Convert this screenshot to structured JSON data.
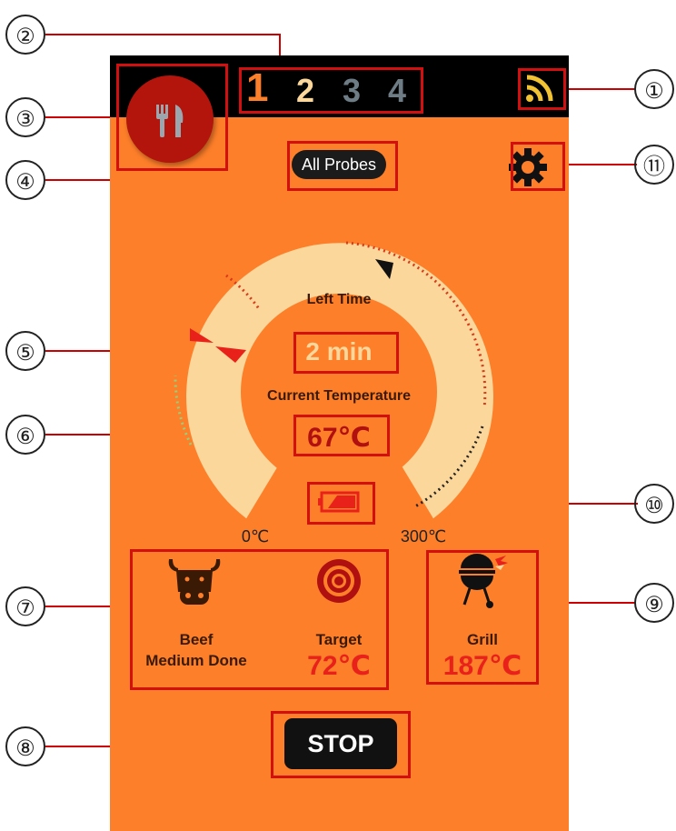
{
  "annotations": {
    "n1": "①",
    "n2": "②",
    "n3": "③",
    "n4": "④",
    "n5": "⑤",
    "n6": "⑥",
    "n7": "⑦",
    "n8": "⑧",
    "n9": "⑨",
    "n10": "⑩",
    "n11": "⑪"
  },
  "topbar": {
    "probes": [
      "1",
      "2",
      "3",
      "4"
    ],
    "selected_probe": "1",
    "wifi_icon": "wifi-signal-icon"
  },
  "header": {
    "menu_icon": "fork-knife-icon",
    "all_probes_label": "All Probes",
    "settings_icon": "gear-icon"
  },
  "gauge": {
    "left_time_label": "Left Time",
    "left_time_value": "2 min",
    "current_temp_label": "Current Temperature",
    "current_temp_value": "67℃",
    "min_label": "0℃",
    "max_label": "300℃",
    "battery_icon": "battery-low-icon"
  },
  "meat": {
    "icon": "cow-icon",
    "name": "Beef",
    "doneness": "Medium Done",
    "target_icon": "target-icon",
    "target_label": "Target",
    "target_value": "72℃"
  },
  "grill": {
    "icon": "grill-icon",
    "label": "Grill",
    "value": "187℃"
  },
  "actions": {
    "stop_label": "STOP"
  },
  "colors": {
    "background": "#fe7f2a",
    "topbar": "#000000",
    "accent_red": "#e8221a",
    "gauge_track": "#fbd79b",
    "fab": "#b3140b"
  }
}
